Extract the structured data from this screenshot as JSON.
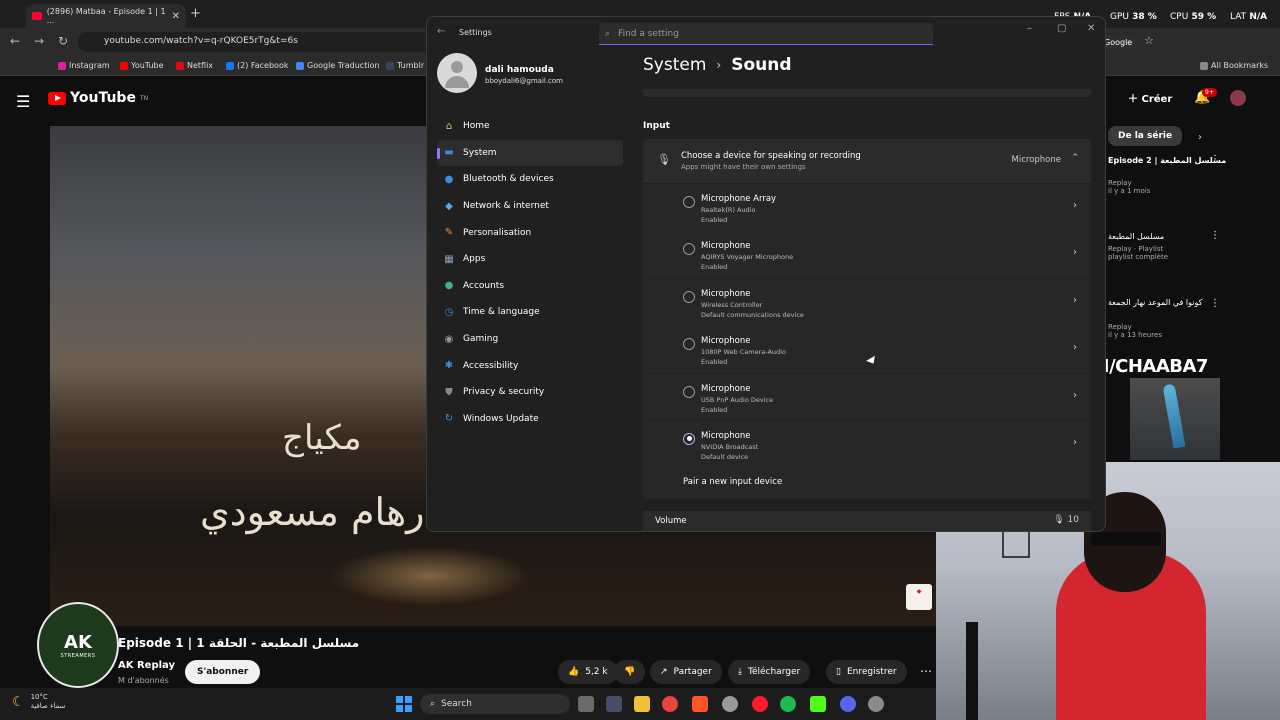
{
  "browser": {
    "tab_title": "(2896) Matbaa - Episode 1 | 1 ...",
    "url": "youtube.com/watch?v=q-rQKOE5rTg&t=6s",
    "bookmarks": [
      "Instagram",
      "YouTube",
      "Netflix",
      "(2) Facebook",
      "Google Traduction",
      "Tumblr"
    ],
    "all_bookmarks": "All Bookmarks",
    "google_chip": "Google"
  },
  "overlay_stats": {
    "fps_label": "FPS",
    "fps_value": "N/A",
    "gpu_label": "GPU",
    "gpu_value": "38 %",
    "cpu_label": "CPU",
    "cpu_value": "59 %",
    "lat_label": "LAT",
    "lat_value": "N/A"
  },
  "youtube": {
    "logo": "YouTube",
    "logo_suffix": "TN",
    "create_label": "Créer",
    "notif_count": "9+",
    "video_text_1": "مكياج",
    "video_text_2": "رهام مسعودي",
    "video_title": "Episode 1 | 1 مسلسل المطبعة - الحلقة",
    "channel": "AK Replay",
    "subs": "M d'abonnés",
    "subscribe": "S'abonner",
    "likes": "5,2 k",
    "share": "Partager",
    "download": "Télécharger",
    "save": "Enregistrer",
    "logo_badge_ak": "AK",
    "logo_badge_st": "STREAMERS",
    "sidebar": {
      "chip": "De la série",
      "items": [
        {
          "title": "Episode 2 | مسلسل المطبعة",
          "meta": "Replay",
          "meta2": "il y a 1 mois"
        },
        {
          "title": "مسلسل المطبعة",
          "meta": "Replay · Playlist",
          "meta2": "playlist complète"
        },
        {
          "title": "كونوا في الموعد نهار الجمعة",
          "meta": "Replay",
          "meta2": "il y a 13 heures"
        }
      ]
    }
  },
  "kick": {
    "prefix": "K",
    "rest": "ICK.COM/CHAABA7"
  },
  "taskbar": {
    "temp": "10°C",
    "weather": "سماء صافية",
    "search": "Search"
  },
  "settings": {
    "app_title": "Settings",
    "search_placeholder": "Find a setting",
    "user_name": "dali hamouda",
    "user_email": "bboydali6@gmail.com",
    "nav": [
      {
        "label": "Home",
        "icon": "home-icon",
        "color": "#e6c160"
      },
      {
        "label": "System",
        "icon": "system-icon",
        "color": "#3a8edb"
      },
      {
        "label": "Bluetooth & devices",
        "icon": "bluetooth-icon",
        "color": "#3a8edb"
      },
      {
        "label": "Network & internet",
        "icon": "wifi-icon",
        "color": "#5aa9e6"
      },
      {
        "label": "Personalisation",
        "icon": "brush-icon",
        "color": "#e38c4a"
      },
      {
        "label": "Apps",
        "icon": "apps-icon",
        "color": "#8fa2b8"
      },
      {
        "label": "Accounts",
        "icon": "accounts-icon",
        "color": "#3fb27f"
      },
      {
        "label": "Time & language",
        "icon": "clock-globe-icon",
        "color": "#3a8edb"
      },
      {
        "label": "Gaming",
        "icon": "gamepad-icon",
        "color": "#9a9a9a"
      },
      {
        "label": "Accessibility",
        "icon": "accessibility-icon",
        "color": "#3a8edb"
      },
      {
        "label": "Privacy & security",
        "icon": "shield-icon",
        "color": "#8a8a8a"
      },
      {
        "label": "Windows Update",
        "icon": "update-icon",
        "color": "#3a8edb"
      }
    ],
    "breadcrumb_parent": "System",
    "breadcrumb_sep": "›",
    "breadcrumb_current": "Sound",
    "input_section": "Input",
    "choose_title": "Choose a device for speaking or recording",
    "choose_sub": "Apps might have their own settings",
    "choose_value": "Microphone",
    "devices": [
      {
        "name": "Microphone Array",
        "sub1": "Realtek(R) Audio",
        "sub2": "Enabled",
        "selected": false
      },
      {
        "name": "Microphone",
        "sub1": "AQIRYS Voyager Microphone",
        "sub2": "Enabled",
        "selected": false
      },
      {
        "name": "Microphone",
        "sub1": "Wireless Controller",
        "sub2": "Default communications device",
        "selected": false
      },
      {
        "name": "Microphone",
        "sub1": "1080P Web Camera-Audio",
        "sub2": "Enabled",
        "selected": false
      },
      {
        "name": "Microphone",
        "sub1": "USB PnP Audio Device",
        "sub2": "Enabled",
        "selected": false
      },
      {
        "name": "Microphone",
        "sub1": "NVIDIA Broadcast",
        "sub2": "Default device",
        "selected": true
      }
    ],
    "pair_label": "Pair a new input device",
    "volume_label": "Volume",
    "volume_value": "10"
  }
}
